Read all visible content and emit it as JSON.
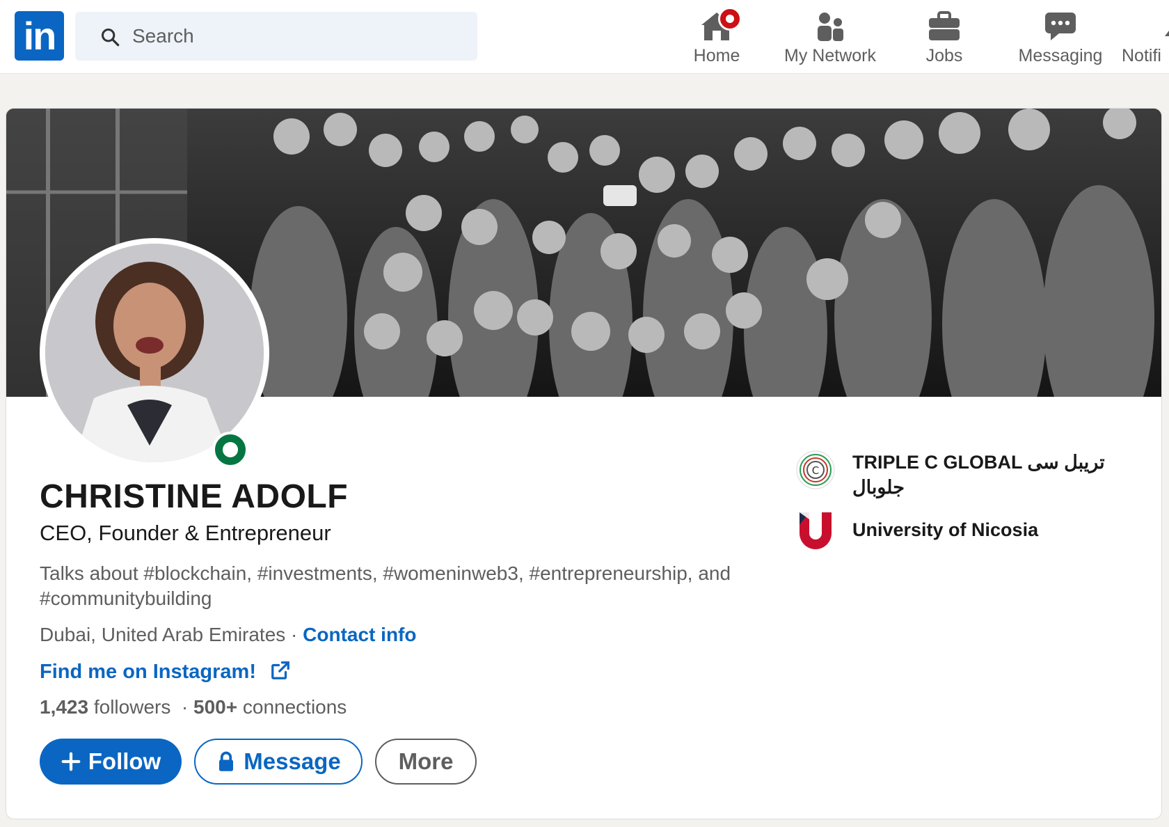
{
  "topnav": {
    "logo_text": "in",
    "search": {
      "placeholder": "Search"
    },
    "items": [
      {
        "label": "Home",
        "icon": "home-icon"
      },
      {
        "label": "My Network",
        "icon": "people-icon"
      },
      {
        "label": "Jobs",
        "icon": "briefcase-icon"
      },
      {
        "label": "Messaging",
        "icon": "chat-icon"
      },
      {
        "label": "Notifi",
        "icon": "bell-icon"
      }
    ]
  },
  "profile": {
    "name": "CHRISTINE ADOLF",
    "headline": "CEO, Founder & Entrepreneur",
    "about": "Talks about #blockchain, #investments, #womeninweb3, #entrepreneurship, and #communitybuilding",
    "location": "Dubai, United Arab Emirates",
    "separator": " · ",
    "contact_label": "Contact info",
    "link_label": "Find me on Instagram!",
    "followers_count": "1,423",
    "followers_label": "followers",
    "connections_count": "500+",
    "connections_label": "connections",
    "status": "online"
  },
  "actions": {
    "follow": "Follow",
    "message": "Message",
    "more": "More"
  },
  "organizations": [
    {
      "name": "TRIPLE C GLOBAL تريبل سى جلوبال",
      "icon": "triple-c-logo"
    },
    {
      "name": "University of Nicosia",
      "icon": "unic-logo"
    }
  ],
  "colors": {
    "brand": "#0a66c2",
    "online": "#057642",
    "notification": "#cc1016"
  }
}
